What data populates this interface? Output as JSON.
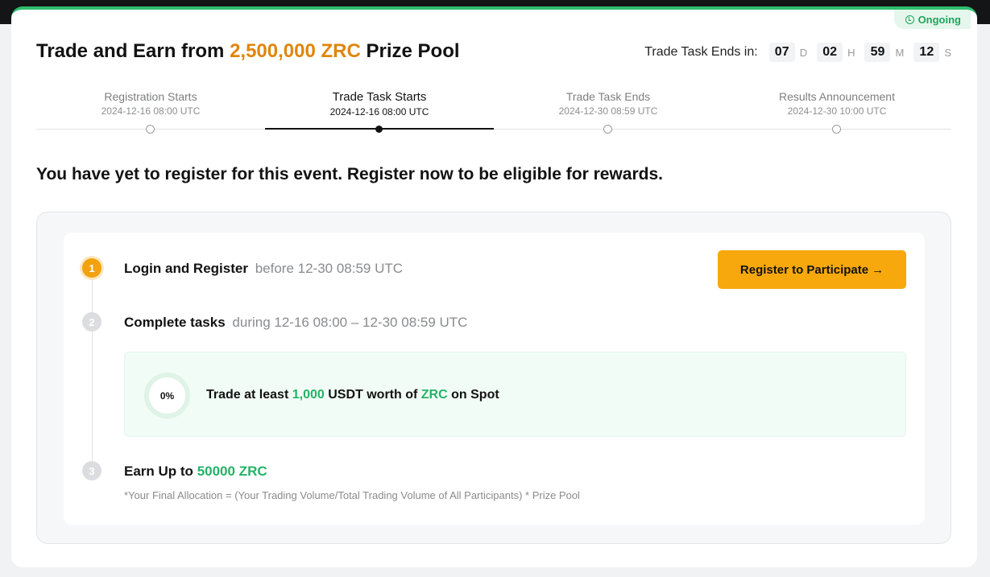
{
  "badge": {
    "label": "Ongoing",
    "icon": "clock-icon"
  },
  "header": {
    "title_prefix": "Trade and Earn from",
    "title_amount": "2,500,000 ZRC",
    "title_suffix": "Prize Pool",
    "accent_color": "#e0850c"
  },
  "countdown": {
    "label": "Trade Task Ends in:",
    "days": "07",
    "days_unit": "D",
    "hours": "02",
    "hours_unit": "H",
    "minutes": "59",
    "minutes_unit": "M",
    "seconds": "12",
    "seconds_unit": "S"
  },
  "timeline": [
    {
      "name": "Registration Starts",
      "date": "2024-12-16 08:00 UTC"
    },
    {
      "name": "Trade Task Starts",
      "date": "2024-12-16 08:00 UTC"
    },
    {
      "name": "Trade Task Ends",
      "date": "2024-12-30 08:59 UTC"
    },
    {
      "name": "Results Announcement",
      "date": "2024-12-30 10:00 UTC"
    }
  ],
  "register_notice": "You have yet to register for this event. Register now to be eligible for rewards.",
  "steps": [
    {
      "number": "1",
      "title": "Login and Register",
      "detail": "before 12-30 08:59 UTC"
    },
    {
      "number": "2",
      "title": "Complete tasks",
      "detail": "during 12-16 08:00 – 12-30 08:59 UTC"
    },
    {
      "number": "3",
      "title": "Earn Up to",
      "amount": "50000 ZRC"
    }
  ],
  "register_button": {
    "label": "Register to Participate",
    "arrow": "→"
  },
  "task": {
    "progress": "0%",
    "text_1": "Trade at least",
    "amount": "1,000",
    "text_2": "USDT worth of",
    "token": "ZRC",
    "text_3": "on Spot"
  },
  "formula": "*Your Final Allocation = (Your Trading Volume/Total Trading Volume of All Participants) * Prize Pool",
  "colors": {
    "brand_green": "#25b267",
    "button_orange": "#f6a80d",
    "active_step": "#f2a20f"
  }
}
